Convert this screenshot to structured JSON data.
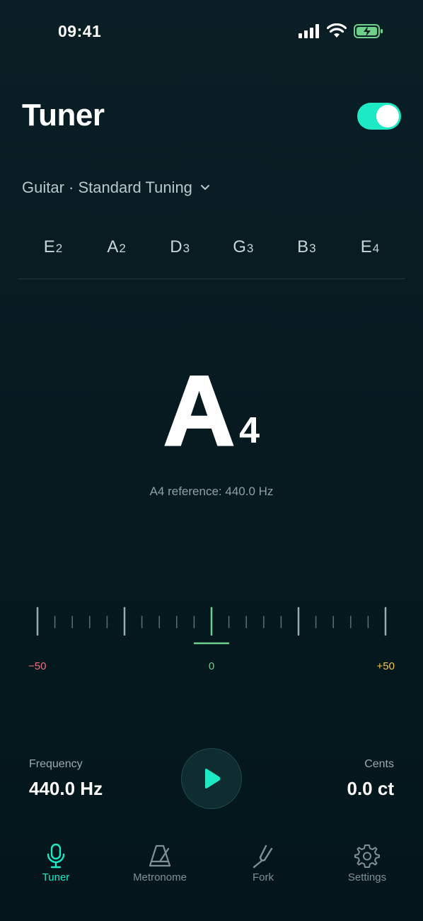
{
  "status_bar": {
    "time": "09:41"
  },
  "header": {
    "title": "Tuner",
    "toggle_on": true
  },
  "instrument": {
    "label": "Guitar · Standard Tuning"
  },
  "strings": [
    {
      "note": "E",
      "octave": "2"
    },
    {
      "note": "A",
      "octave": "2"
    },
    {
      "note": "D",
      "octave": "3"
    },
    {
      "note": "G",
      "octave": "3"
    },
    {
      "note": "B",
      "octave": "3"
    },
    {
      "note": "E",
      "octave": "4"
    }
  ],
  "detected": {
    "note": "A",
    "octave": "4",
    "reference": "A4 reference: 440.0 Hz"
  },
  "meter": {
    "min_label": "−50",
    "zero_label": "0",
    "max_label": "+50",
    "cents_offset": 0,
    "range": [
      -50,
      50
    ]
  },
  "readouts": {
    "frequency_label": "Frequency",
    "frequency_value": "440.0 Hz",
    "cents_label": "Cents",
    "cents_value": "0.0 ct"
  },
  "tabs": [
    {
      "label": "Tuner",
      "icon": "microphone-icon",
      "active": true
    },
    {
      "label": "Metronome",
      "icon": "metronome-icon",
      "active": false
    },
    {
      "label": "Fork",
      "icon": "tuning-fork-icon",
      "active": false
    },
    {
      "label": "Settings",
      "icon": "gear-icon",
      "active": false
    }
  ],
  "colors": {
    "accent": "#1de9c4",
    "flat": "#f0707a",
    "in_tune": "#6ecf8a",
    "sharp": "#f3c64a"
  }
}
